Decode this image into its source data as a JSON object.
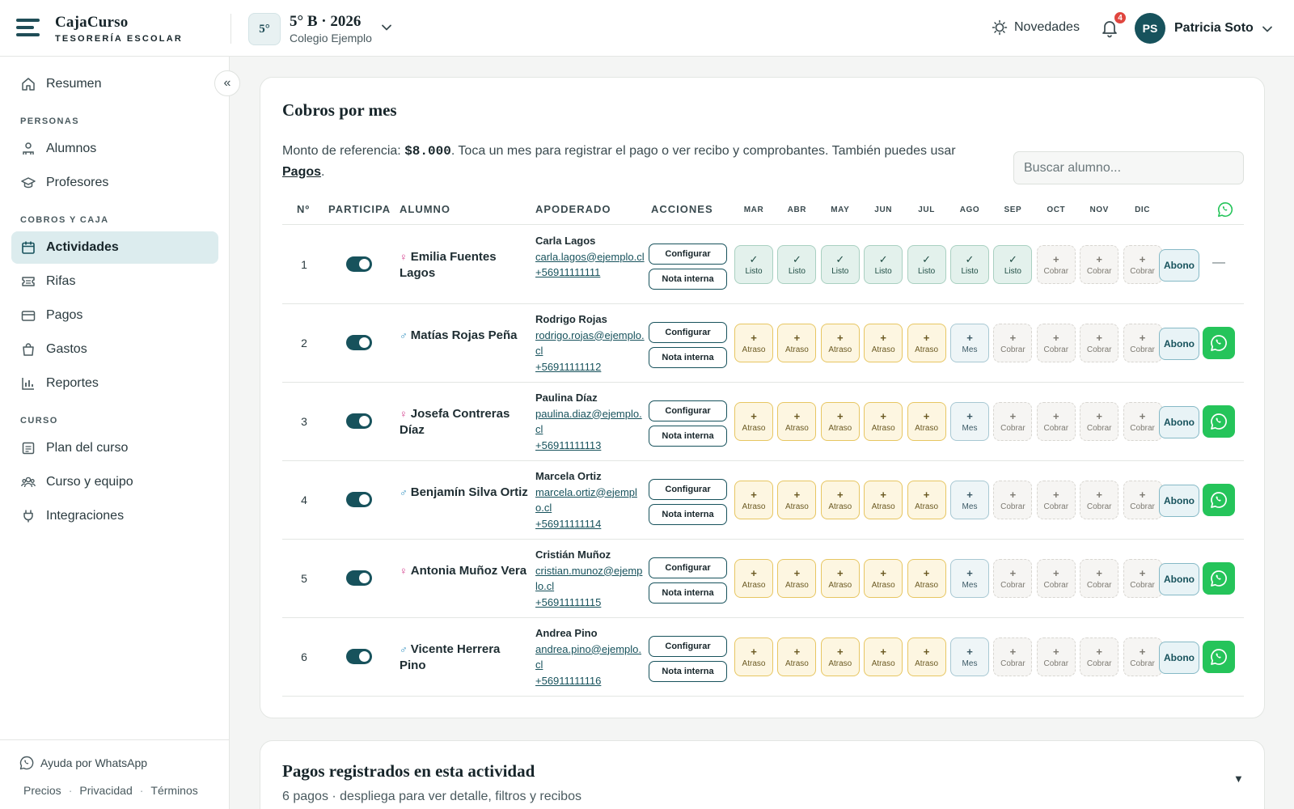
{
  "header": {
    "brand_name": "CajaCurso",
    "brand_sub": "TESORERÍA ESCOLAR",
    "course_badge": "5°",
    "course_title": "5° B · 2026",
    "course_school": "Colegio Ejemplo",
    "news_label": "Novedades",
    "notif_count": "4",
    "user_initials": "PS",
    "user_name": "Patricia Soto"
  },
  "sidebar": {
    "summary": "Resumen",
    "sections": {
      "personas": "PERSONAS",
      "cobros": "COBROS Y CAJA",
      "curso": "CURSO"
    },
    "items": {
      "alumnos": "Alumnos",
      "profesores": "Profesores",
      "actividades": "Actividades",
      "rifas": "Rifas",
      "pagos": "Pagos",
      "gastos": "Gastos",
      "reportes": "Reportes",
      "plan": "Plan del curso",
      "equipo": "Curso y equipo",
      "integraciones": "Integraciones"
    },
    "help": "Ayuda por WhatsApp",
    "footer": {
      "precios": "Precios",
      "privacidad": "Privacidad",
      "terminos": "Términos",
      "sep": "·"
    }
  },
  "main": {
    "title": "Cobros por mes",
    "desc_pre": "Monto de referencia: ",
    "desc_amount": "$8.000",
    "desc_post": ". Toca un mes para registrar el pago o ver recibo y comprobantes. También puedes usar ",
    "desc_link": "Pagos",
    "desc_end": ".",
    "search_placeholder": "Buscar alumno...",
    "columns": {
      "num": "Nº",
      "participa": "PARTICIPA",
      "alumno": "ALUMNO",
      "apoderado": "APODERADO",
      "acciones": "ACCIONES"
    },
    "months": [
      "MAR",
      "ABR",
      "MAY",
      "JUN",
      "JUL",
      "AGO",
      "SEP",
      "OCT",
      "NOV",
      "DIC"
    ],
    "btn_configurar": "Configurar",
    "btn_nota": "Nota interna",
    "btn_abono": "Abono",
    "no_whatsapp": "—",
    "cell_labels": {
      "ok": "Listo",
      "late": "Atraso",
      "mes": "Mes",
      "due": "Cobrar"
    },
    "cell_symbols": {
      "ok": "✓",
      "late": "+",
      "mes": "+",
      "due": "+"
    },
    "rows": [
      {
        "num": "1",
        "gender": "♀",
        "gender_class": "f",
        "student": "Emilia Fuentes Lagos",
        "guardian": "Carla Lagos",
        "email": "carla.lagos@ejemplo.cl",
        "phone": "+56911111111",
        "participa": true,
        "whatsapp": false,
        "months": [
          "ok",
          "ok",
          "ok",
          "ok",
          "ok",
          "ok",
          "ok",
          "due",
          "due",
          "due"
        ]
      },
      {
        "num": "2",
        "gender": "♂",
        "gender_class": "m",
        "student": "Matías Rojas Peña",
        "guardian": "Rodrigo Rojas",
        "email": "rodrigo.rojas@ejemplo.cl",
        "phone": "+56911111112",
        "participa": true,
        "whatsapp": true,
        "months": [
          "late",
          "late",
          "late",
          "late",
          "late",
          "mes",
          "due",
          "due",
          "due",
          "due"
        ]
      },
      {
        "num": "3",
        "gender": "♀",
        "gender_class": "f",
        "student": "Josefa Contreras Díaz",
        "guardian": "Paulina Díaz",
        "email": "paulina.diaz@ejemplo.cl",
        "phone": "+56911111113",
        "participa": true,
        "whatsapp": true,
        "months": [
          "late",
          "late",
          "late",
          "late",
          "late",
          "mes",
          "due",
          "due",
          "due",
          "due"
        ]
      },
      {
        "num": "4",
        "gender": "♂",
        "gender_class": "m",
        "student": "Benjamín Silva Ortiz",
        "guardian": "Marcela Ortiz",
        "email": "marcela.ortiz@ejemplo.cl",
        "phone": "+56911111114",
        "participa": true,
        "whatsapp": true,
        "months": [
          "late",
          "late",
          "late",
          "late",
          "late",
          "mes",
          "due",
          "due",
          "due",
          "due"
        ]
      },
      {
        "num": "5",
        "gender": "♀",
        "gender_class": "f",
        "student": "Antonia Muñoz Vera",
        "guardian": "Cristián Muñoz",
        "email": "cristian.munoz@ejemplo.cl",
        "phone": "+56911111115",
        "participa": true,
        "whatsapp": true,
        "months": [
          "late",
          "late",
          "late",
          "late",
          "late",
          "mes",
          "due",
          "due",
          "due",
          "due"
        ]
      },
      {
        "num": "6",
        "gender": "♂",
        "gender_class": "m",
        "student": "Vicente Herrera Pino",
        "guardian": "Andrea Pino",
        "email": "andrea.pino@ejemplo.cl",
        "phone": "+56911111116",
        "participa": true,
        "whatsapp": true,
        "months": [
          "late",
          "late",
          "late",
          "late",
          "late",
          "mes",
          "due",
          "due",
          "due",
          "due"
        ]
      }
    ]
  },
  "payments_card": {
    "title": "Pagos registrados en esta actividad",
    "subtitle": "6 pagos · despliega para ver detalle, filtros y recibos",
    "toggle_icon": "▼"
  },
  "colors": {
    "brand": "#17525c",
    "active_nav": "#dcecee",
    "whatsapp": "#25c45a",
    "late_border": "#e7c662",
    "ok_bg": "#e3f1ec"
  },
  "icons": [
    "menu-icon",
    "chevron-down-icon",
    "bulb-icon",
    "bell-icon",
    "home-icon",
    "users-icon",
    "graduation-icon",
    "calendar-icon",
    "ticket-icon",
    "card-icon",
    "bag-icon",
    "chart-icon",
    "list-icon",
    "team-icon",
    "plug-icon",
    "whatsapp-icon",
    "collapse-icon"
  ]
}
